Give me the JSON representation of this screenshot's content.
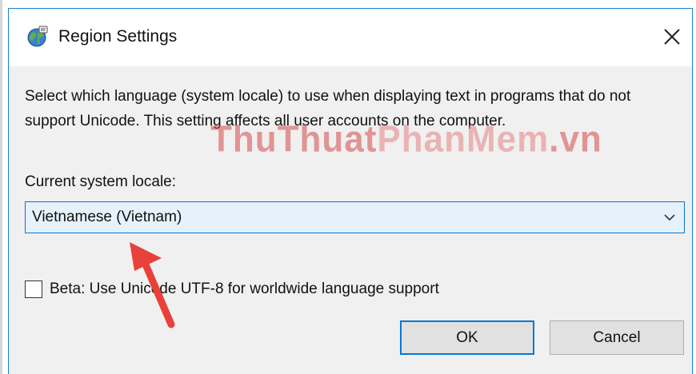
{
  "window": {
    "title": "Region Settings",
    "app_icon": "region-globe-icon",
    "close_icon": "close-icon",
    "accent_color": "#0078d7"
  },
  "dialog": {
    "description": "Select which language (system locale) to use when displaying text in programs that do not support Unicode. This setting affects all user accounts on the computer.",
    "locale_label": "Current system locale:",
    "locale_selected": "Vietnamese (Vietnam)",
    "beta_label": "Beta: Use Unicode UTF-8 for worldwide language support",
    "beta_checked": false,
    "ok_label": "OK",
    "cancel_label": "Cancel"
  },
  "watermark": {
    "part1": "ThuThuat",
    "part2": "PhanMem",
    "part3": ".vn"
  },
  "annotation": {
    "arrow_color": "#e8413a"
  }
}
